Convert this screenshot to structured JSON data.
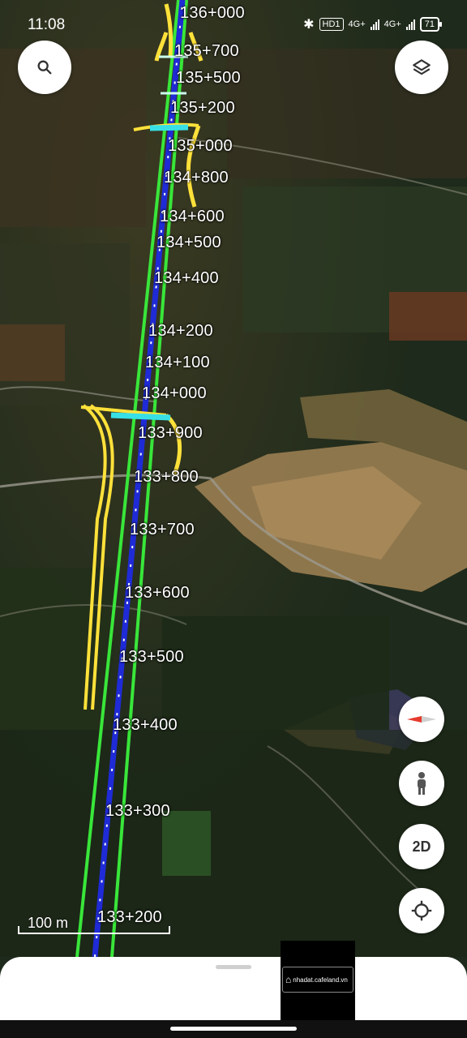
{
  "status_bar": {
    "time": "11:08",
    "hd_badge": "HD1",
    "network_1": "4G+",
    "network_2": "4G+",
    "battery": "71"
  },
  "map_buttons": {
    "search_icon": "search-icon",
    "layers_icon": "layers-icon",
    "compass_icon": "compass-icon",
    "street_view_icon": "pegman-icon",
    "view_mode_label": "2D",
    "locate_icon": "my-location-icon"
  },
  "chainage_labels": [
    "136+000",
    "135+700",
    "135+500",
    "135+200",
    "135+000",
    "134+800",
    "134+600",
    "134+500",
    "134+400",
    "134+200",
    "134+100",
    "134+000",
    "133+900",
    "133+800",
    "133+700",
    "133+600",
    "133+500",
    "133+400",
    "133+300",
    "133+200"
  ],
  "scale_bar": {
    "label": "100 m"
  },
  "watermark": {
    "text": "nhadat.cafeland.vn"
  },
  "colors": {
    "route_centerline": "#1f2bd6",
    "route_edges": "#39e63a",
    "interchange_ramps": "#ffe13a",
    "interchange_bridge": "#38e0e6"
  }
}
